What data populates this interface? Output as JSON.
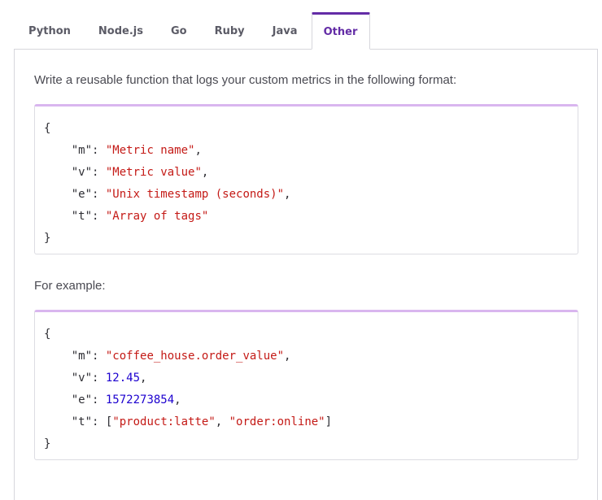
{
  "tabs": [
    {
      "label": "Python",
      "active": false
    },
    {
      "label": "Node.js",
      "active": false
    },
    {
      "label": "Go",
      "active": false
    },
    {
      "label": "Ruby",
      "active": false
    },
    {
      "label": "Java",
      "active": false
    },
    {
      "label": "Other",
      "active": true
    }
  ],
  "intro_text": "Write a reusable function that logs your custom metrics in the following format:",
  "format_code": {
    "open": "{",
    "lines": [
      {
        "key": "\"m\"",
        "value": "\"Metric name\"",
        "suffix": ","
      },
      {
        "key": "\"v\"",
        "value": "\"Metric value\"",
        "suffix": ","
      },
      {
        "key": "\"e\"",
        "value": "\"Unix timestamp (seconds)\"",
        "suffix": ","
      },
      {
        "key": "\"t\"",
        "value": "\"Array of tags\"",
        "suffix": ""
      }
    ],
    "close": "}"
  },
  "example_label": "For example:",
  "example_code": {
    "open": "{",
    "m_key": "\"m\"",
    "m_value": "\"coffee_house.order_value\"",
    "v_key": "\"v\"",
    "v_value": "12.45",
    "e_key": "\"e\"",
    "e_value": "1572273854",
    "t_key": "\"t\"",
    "t_value_1": "\"product:latte\"",
    "t_value_2": "\"order:online\"",
    "close": "}"
  },
  "colors": {
    "accent": "#632ca6",
    "code_border_top": "#d9b6ef",
    "string": "#c41a16",
    "number": "#1c00cf"
  }
}
